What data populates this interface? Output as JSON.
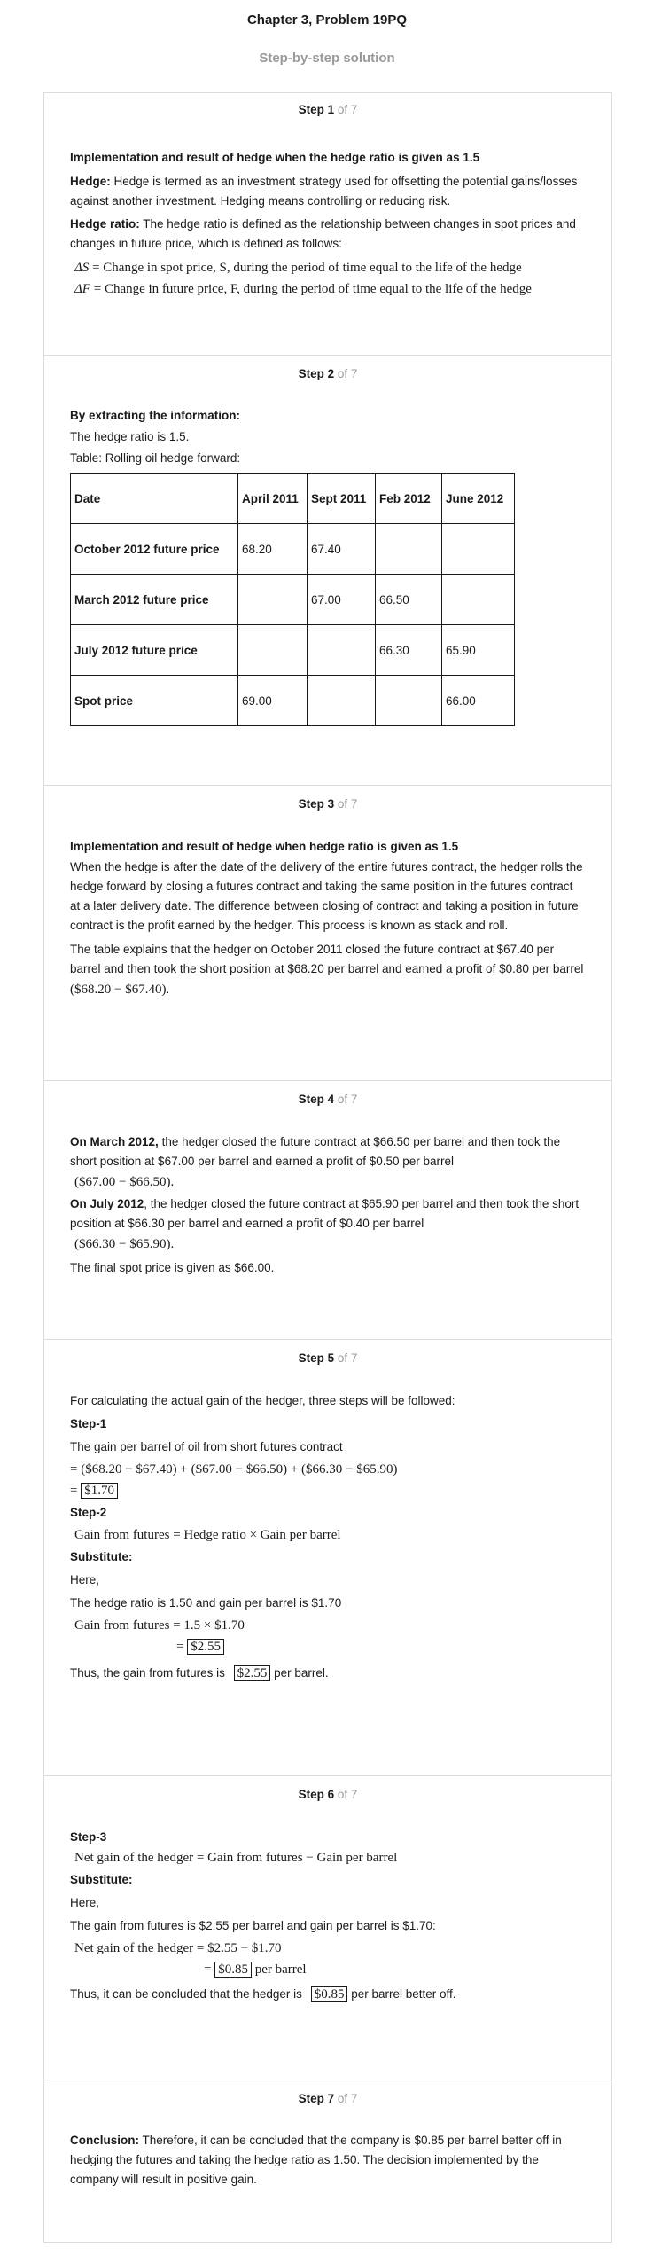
{
  "header": {
    "title": "Chapter 3, Problem 19PQ",
    "subtitle": "Step-by-step solution"
  },
  "steps": [
    {
      "num": "Step 1",
      "of": "of 7",
      "heading": "Implementation and result of hedge when the hedge ratio is given as 1.5",
      "hedge_label": "Hedge:",
      "hedge_text": "Hedge is termed as an investment strategy used for offsetting the potential gains/losses against another investment. Hedging means controlling or reducing risk.",
      "ratio_label": "Hedge ratio:",
      "ratio_text": "The hedge ratio is defined as the relationship between changes in spot prices and changes in future price, which is defined as follows:",
      "eq1_lhs": "ΔS",
      "eq1_rhs": "Change in spot price, S, during the period of time equal to the life of the hedge",
      "eq2_lhs": "ΔF",
      "eq2_rhs": "Change in future price, F, during the period of time equal to the life of the hedge"
    },
    {
      "num": "Step 2",
      "of": "of 7",
      "heading": "By extracting the information:",
      "line1": "The hedge ratio is 1.5.",
      "line2": "Table: Rolling oil hedge forward:",
      "table": {
        "headers": [
          "Date",
          "April 2011",
          "Sept 2011",
          "Feb 2012",
          "June 2012"
        ],
        "rows": [
          [
            "October 2012 future price",
            "68.20",
            "67.40",
            "",
            ""
          ],
          [
            "March 2012 future price",
            "",
            "67.00",
            "66.50",
            ""
          ],
          [
            "July 2012 future price",
            "",
            "",
            "66.30",
            "65.90"
          ],
          [
            "Spot price",
            "69.00",
            "",
            "",
            "66.00"
          ]
        ]
      }
    },
    {
      "num": "Step 3",
      "of": "of 7",
      "heading": "Implementation and result of hedge when hedge ratio is given as 1.5",
      "para1": "When the hedge is after the date of the delivery of the entire futures contract, the hedger rolls the hedge forward by closing a futures contract and taking the same position in the futures contract at a later delivery date. The difference between closing of contract and taking a position in future contract is the profit earned by the hedger. This process is known as stack and roll.",
      "para2": "The table explains that the hedger on October 2011 closed the future contract at $67.40 per barrel and then took the short position at $68.20 per barrel and earned a profit of $0.80 per barrel",
      "para2_math": "($68.20 − $67.40)"
    },
    {
      "num": "Step 4",
      "of": "of 7",
      "march_label": "On March 2012,",
      "march_text": "the hedger closed the future contract at $66.50 per barrel and then took the short position at $67.00 per barrel and earned a profit of $0.50 per barrel",
      "march_math": "($67.00 − $66.50)",
      "july_label": "On July 2012",
      "july_text": ", the hedger closed the future contract at $65.90 per barrel and then took the short position at $66.30 per barrel and earned a profit of $0.40 per barrel",
      "july_math": "($66.30 − $65.90)",
      "final": "The final spot price is given as $66.00."
    },
    {
      "num": "Step 5",
      "of": "of 7",
      "intro": "For calculating the actual gain of the hedger, three steps will be followed:",
      "s1_label": "Step-1",
      "s1_text": "The gain per barrel of oil from short futures contract",
      "s1_expr": "= ($68.20 − $67.40) + ($67.00 − $66.50) + ($66.30 − $65.90)",
      "s1_result": "$1.70",
      "s2_label": "Step-2",
      "s2_expr": "Gain from futures = Hedge ratio × Gain per barrel",
      "sub_label": "Substitute:",
      "here": "Here,",
      "given": "The hedge ratio is 1.50 and gain per barrel is $1.70",
      "calc_lhs": "Gain from futures = 1.5 × $1.70",
      "calc_result": "$2.55",
      "thus_pre": "Thus, the gain from futures is",
      "thus_val": "$2.55",
      "thus_post": "per barrel."
    },
    {
      "num": "Step 6",
      "of": "of 7",
      "s3_label": "Step-3",
      "s3_expr": "Net gain of the hedger = Gain from futures − Gain per barrel",
      "sub_label": "Substitute:",
      "here": "Here,",
      "given": "The gain from futures is $2.55 per barrel and gain per barrel is $1.70:",
      "calc_lhs": "Net gain of the hedger = $2.55 − $1.70",
      "calc_result": "$0.85",
      "calc_unit": "per barrel",
      "thus_pre": "Thus, it can be concluded that the hedger is",
      "thus_val": "$0.85",
      "thus_post": "per barrel better off."
    },
    {
      "num": "Step 7",
      "of": "of 7",
      "concl_label": "Conclusion:",
      "concl_text": "Therefore, it can be concluded that the company is $0.85 per barrel better off in hedging the futures and taking the hedge ratio as 1.50. The decision implemented by the company will result in positive gain."
    }
  ]
}
